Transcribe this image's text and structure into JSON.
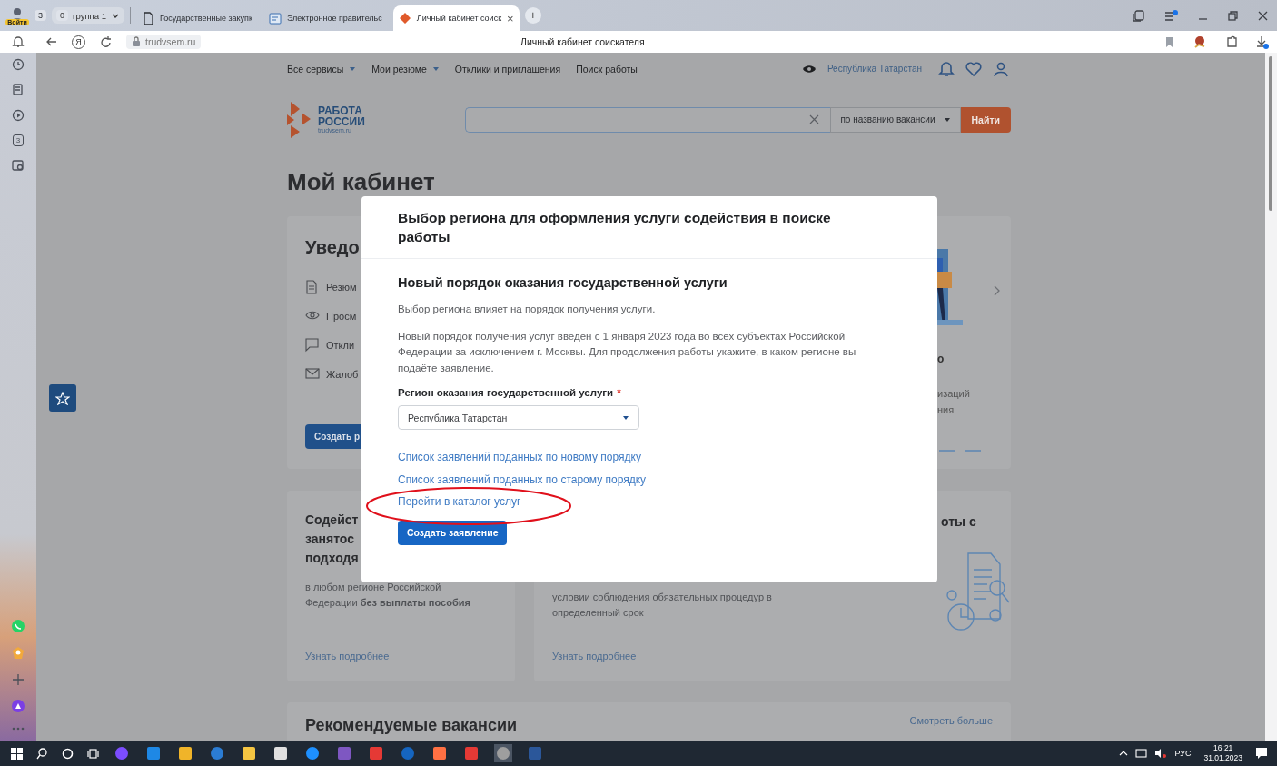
{
  "browser": {
    "sign_in": "Войти",
    "tab_count": "3",
    "group": {
      "count": "0",
      "label": "группа 1"
    },
    "tabs": [
      {
        "title": "Государственные закупк",
        "kind": "document",
        "selected": false
      },
      {
        "title": "Электронное правительс",
        "kind": "gov",
        "selected": false
      },
      {
        "title": "Личный кабинет соиск",
        "kind": "logo",
        "selected": true,
        "close": "×"
      }
    ],
    "new_tab": "+",
    "yandex": "Я",
    "address": "trudvsem.ru",
    "page_title": "Личный кабинет соискателя",
    "sidebar_counter": "3"
  },
  "page": {
    "nav": [
      {
        "label": "Все сервисы",
        "dropdown": true
      },
      {
        "label": "Мои резюме",
        "dropdown": true
      },
      {
        "label": "Отклики и приглашения",
        "dropdown": false
      },
      {
        "label": "Поиск работы",
        "dropdown": false
      }
    ],
    "region": "Республика Татарстан",
    "logo": {
      "line1": "РАБОТА",
      "line2": "РОССИИ",
      "domain": "trudvsem.ru"
    },
    "search": {
      "filter": "по названию вакансии",
      "button": "Найти"
    },
    "heading": "Мой кабинет",
    "notifications": {
      "title": "Уведо",
      "items": [
        {
          "kind": "document",
          "label": "Резюм"
        },
        {
          "kind": "eye",
          "label": "Просм"
        },
        {
          "kind": "chat",
          "label": "Откли"
        },
        {
          "kind": "mail",
          "label": "Жалоб"
        }
      ],
      "button": "Создать р"
    },
    "promo": {
      "title": "о",
      "lines": [
        "изаций",
        "ния"
      ]
    },
    "services": [
      {
        "title_lines": [
          "Содейст",
          "занятос",
          "подходя"
        ],
        "text_lines": [
          "в любом регионе Российской",
          "Федерации **без выплаты пособия**"
        ],
        "link": "Узнать подробнее"
      },
      {
        "title_lines": [
          "оты с"
        ],
        "text_lines": [
          "условии соблюдения обязательных процедур в",
          "определенный срок"
        ],
        "link": "Узнать подробнее"
      }
    ],
    "recommended": {
      "title": "Рекомендуемые вакансии",
      "link": "Смотреть больше"
    }
  },
  "modal": {
    "title": "Выбор региона для оформления услуги содействия в поиске работы",
    "subtitle": "Новый порядок оказания государственной услуги",
    "paragraphs": [
      "Выбор региона влияет на порядок получения услуги.",
      "Новый порядок получения услуг введен с 1 января 2023 года во всех субъектах Российской Федерации за исключением г. Москвы. Для продолжения работы укажите, в каком регионе вы подаёте заявление."
    ],
    "field_label": "Регион оказания государственной услуги",
    "required_mark": "*",
    "region_value": "Республика Татарстан",
    "links": [
      "Список заявлений поданных по новому порядку",
      "Список заявлений поданных по старому порядку",
      "Перейти в каталог услуг"
    ],
    "button": "Создать заявление"
  },
  "taskbar": {
    "language": "РУС",
    "time": "16:21",
    "date": "31.01.2023"
  }
}
